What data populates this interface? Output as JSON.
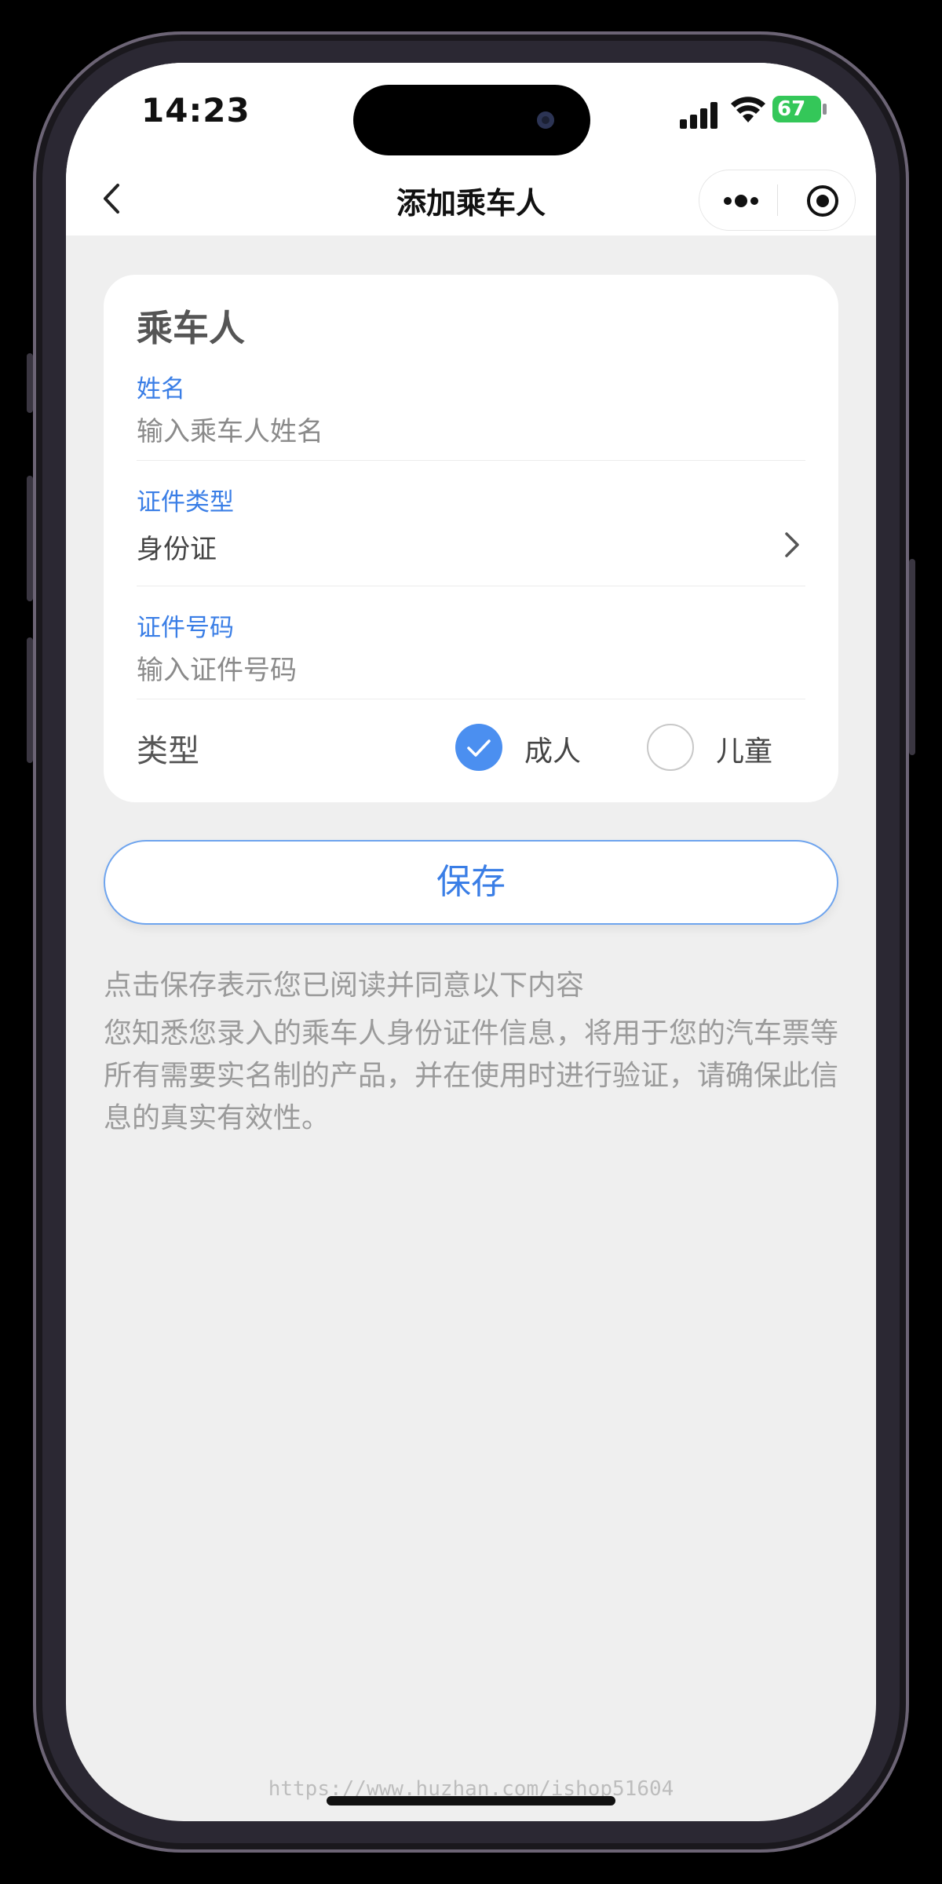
{
  "status_bar": {
    "time": "14:23",
    "battery": "67"
  },
  "nav": {
    "title": "添加乘车人"
  },
  "form": {
    "section_title": "乘车人",
    "name": {
      "label": "姓名",
      "placeholder": "输入乘车人姓名"
    },
    "id_type": {
      "label": "证件类型",
      "value": "身份证"
    },
    "id_number": {
      "label": "证件号码",
      "placeholder": "输入证件号码"
    },
    "passenger_type": {
      "label": "类型",
      "options": [
        {
          "label": "成人",
          "selected": true
        },
        {
          "label": "儿童",
          "selected": false
        }
      ]
    }
  },
  "save_button": {
    "label": "保存"
  },
  "notice": {
    "title": "点击保存表示您已阅读并同意以下内容",
    "body": "您知悉您录入的乘车人身份证件信息，将用于您的汽车票等所有需要实名制的产品，并在使用时进行验证，请确保此信息的真实有效性。"
  },
  "watermark": "https://www.huzhan.com/ishop51604",
  "colors": {
    "accent": "#3a7ee6",
    "radio_selected": "#4b8ff0",
    "page_background": "#efefef",
    "battery": "#34c759"
  },
  "icons": [
    "back-chevron-icon",
    "more-dots-icon",
    "target-icon",
    "chevron-right-icon",
    "checkmark-icon",
    "signal-icon",
    "wifi-icon",
    "battery-icon"
  ]
}
